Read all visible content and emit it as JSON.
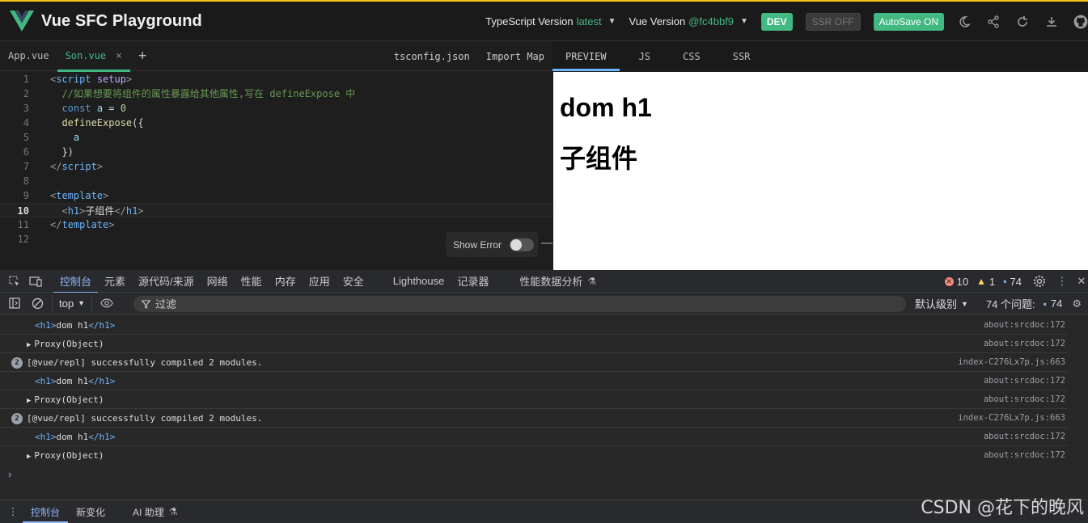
{
  "header": {
    "title": "Vue SFC Playground",
    "ts_label": "TypeScript Version",
    "ts_value": "latest",
    "vue_label": "Vue Version",
    "vue_value": "@fc4bbf9",
    "dev": "DEV",
    "ssr": "SSR OFF",
    "autosave": "AutoSave ON",
    "accent": "#42b883"
  },
  "editor": {
    "tabs": [
      {
        "label": "App.vue"
      },
      {
        "label": "Son.vue"
      }
    ],
    "close_glyph": "×",
    "add_glyph": "+",
    "right_tabs": [
      "tsconfig.json",
      "Import Map"
    ],
    "line_numbers": [
      "1",
      "2",
      "3",
      "4",
      "5",
      "6",
      "7",
      "8",
      "9",
      "10",
      "11",
      "12"
    ],
    "lines": {
      "l2_comment": "//如果想要将组件的属性暴露给其他属性,写在 defineExpose 中",
      "l10_text": "子组件"
    },
    "show_error": "Show Error"
  },
  "preview": {
    "tabs": [
      "PREVIEW",
      "JS",
      "CSS",
      "SSR"
    ],
    "h1_a": "dom h1",
    "h1_b": "子组件"
  },
  "devtools": {
    "tabs": [
      "控制台",
      "元素",
      "源代码/来源",
      "网络",
      "性能",
      "内存",
      "应用",
      "安全",
      "Lighthouse",
      "记录器",
      "性能数据分析"
    ],
    "errors": "10",
    "warnings": "1",
    "messages": "74",
    "context": "top",
    "filter_placeholder": "过滤",
    "level": "默认级别",
    "issues_label": "74 个问题:",
    "issues_count": "74",
    "logs": [
      {
        "kind": "tag",
        "text": "dom h1",
        "src": "about:srcdoc:172"
      },
      {
        "kind": "obj",
        "text": "Proxy(Object)",
        "src": "about:srcdoc:172"
      },
      {
        "kind": "rep",
        "count": "2",
        "text": "[@vue/repl] successfully compiled 2 modules.",
        "src": "index-C276Lx7p.js:663"
      },
      {
        "kind": "tag",
        "text": "dom h1",
        "src": "about:srcdoc:172"
      },
      {
        "kind": "obj",
        "text": "Proxy(Object)",
        "src": "about:srcdoc:172"
      },
      {
        "kind": "rep",
        "count": "2",
        "text": "[@vue/repl] successfully compiled 2 modules.",
        "src": "index-C276Lx7p.js:663"
      },
      {
        "kind": "tag",
        "text": "dom h1",
        "src": "about:srcdoc:172"
      },
      {
        "kind": "obj",
        "text": "Proxy(Object)",
        "src": "about:srcdoc:172"
      }
    ],
    "prompt": "›",
    "drawer_tabs": [
      "控制台",
      "新变化",
      "AI 助理"
    ]
  },
  "watermark": "CSDN @花下的晚风"
}
